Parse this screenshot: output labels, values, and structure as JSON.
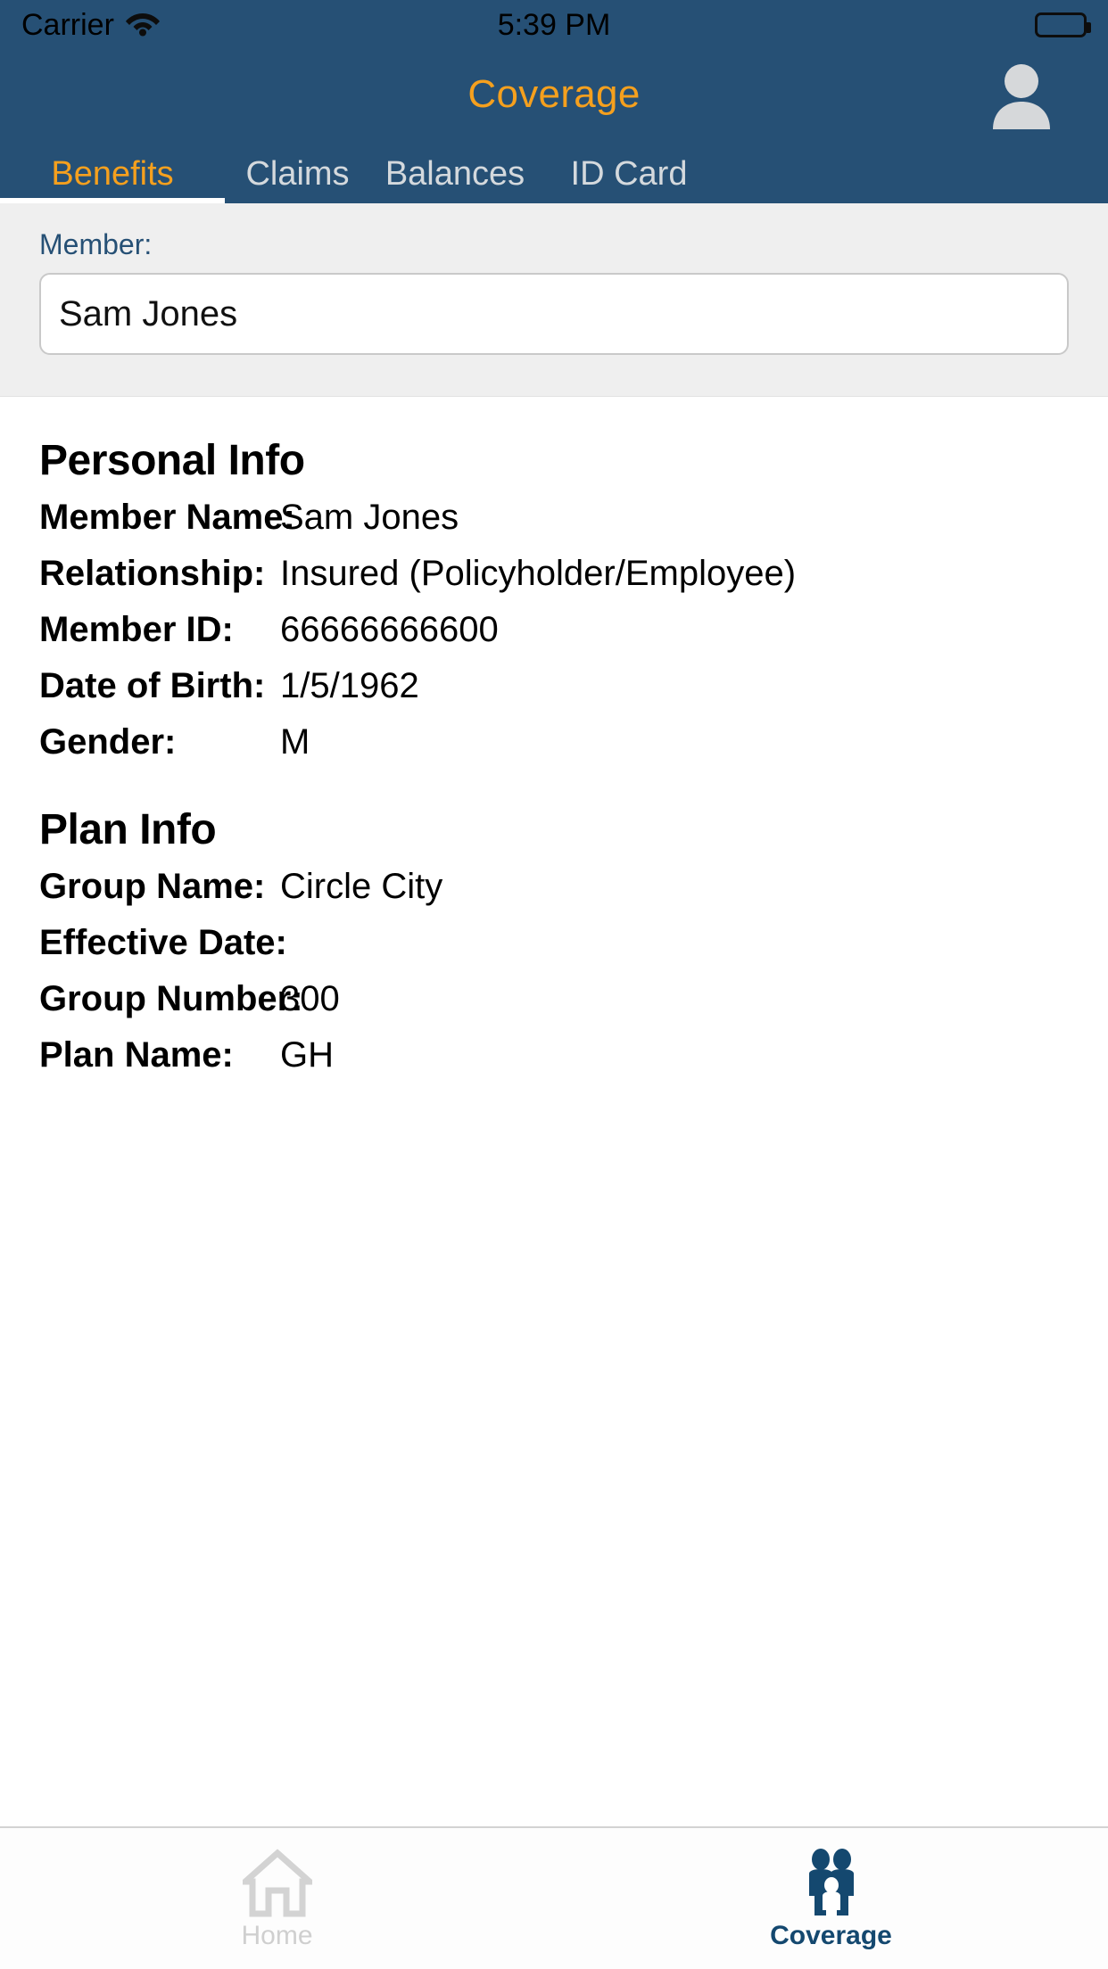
{
  "status_bar": {
    "carrier": "Carrier",
    "time": "5:39 PM",
    "wifi_icon": "wifi-icon",
    "battery_icon": "battery-full-icon"
  },
  "nav_bar": {
    "title": "Coverage",
    "avatar_icon": "person-avatar-icon"
  },
  "top_tabs": {
    "active": "Benefits",
    "items": [
      {
        "label": "Benefits",
        "active": true
      },
      {
        "label": "Claims",
        "active": false
      },
      {
        "label": "Balances",
        "active": false
      },
      {
        "label": "ID Card",
        "active": false
      }
    ]
  },
  "member_picker": {
    "label": "Member:",
    "value": "Sam Jones",
    "placeholder": "Sam Jones"
  },
  "personal_info": {
    "heading": "Personal Info",
    "rows": [
      {
        "label": "Member Name:",
        "value": "Sam Jones"
      },
      {
        "label": "Relationship:",
        "value": "Insured (Policyholder/Employee)"
      },
      {
        "label": "Member ID:",
        "value": "66666666600"
      },
      {
        "label": "Date of Birth:",
        "value": "1/5/1962"
      },
      {
        "label": "Gender:",
        "value": "M"
      }
    ]
  },
  "plan_info": {
    "heading": "Plan Info",
    "rows": [
      {
        "label": "Group Name:",
        "value": "Circle City"
      },
      {
        "label": "Effective Date:",
        "value": ""
      },
      {
        "label": "Group Number:",
        "value": "300"
      },
      {
        "label": "Plan Name:",
        "value": "GH"
      }
    ]
  },
  "bottom_tabs": {
    "items": [
      {
        "label": "Home",
        "icon": "home-icon",
        "active": false
      },
      {
        "label": "Coverage",
        "icon": "family-icon",
        "active": true
      }
    ]
  },
  "colors": {
    "header_blue": "#265075",
    "accent_orange": "#f5a01e",
    "tab_inactive": "#d4d9dd",
    "band_gray": "#efefef",
    "active_tabbar": "#14486f",
    "inactive_tabbar": "#cfcfcf"
  }
}
